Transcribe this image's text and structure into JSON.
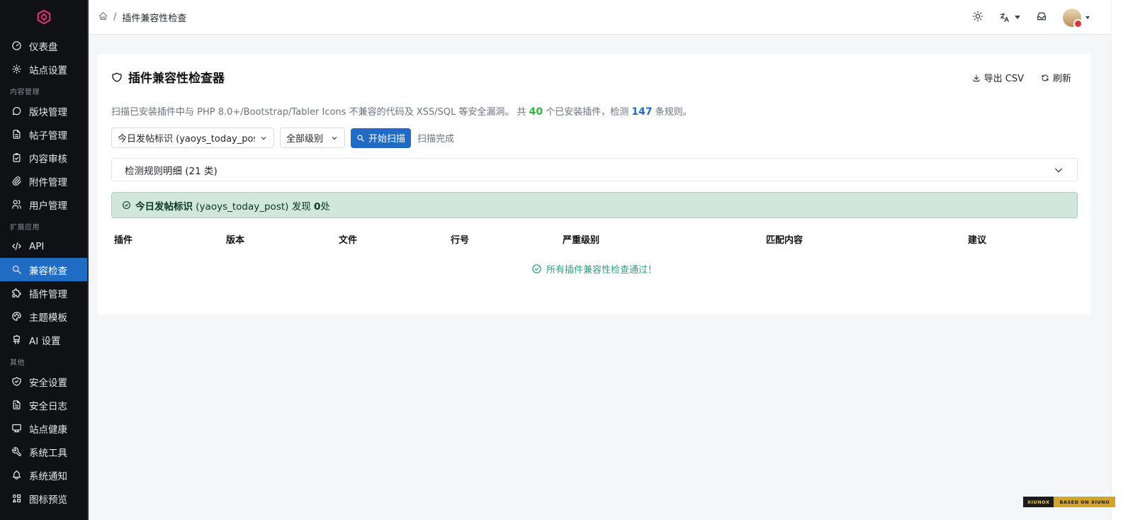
{
  "sidebar": {
    "groups": [
      {
        "label": "",
        "items": [
          {
            "label": "仪表盘",
            "icon": "dashboard-icon"
          },
          {
            "label": "站点设置",
            "icon": "gear-icon"
          }
        ]
      },
      {
        "label": "内容管理",
        "items": [
          {
            "label": "版块管理",
            "icon": "message-icon"
          },
          {
            "label": "帖子管理",
            "icon": "file-icon"
          },
          {
            "label": "内容审核",
            "icon": "clipboard-check-icon"
          },
          {
            "label": "附件管理",
            "icon": "paperclip-icon"
          },
          {
            "label": "用户管理",
            "icon": "users-icon"
          }
        ]
      },
      {
        "label": "扩展应用",
        "items": [
          {
            "label": "API",
            "icon": "code-icon"
          },
          {
            "label": "兼容检查",
            "icon": "search-icon",
            "active": true
          },
          {
            "label": "插件管理",
            "icon": "puzzle-icon"
          },
          {
            "label": "主题模板",
            "icon": "palette-icon"
          },
          {
            "label": "AI 设置",
            "icon": "robot-icon"
          }
        ]
      },
      {
        "label": "其他",
        "items": [
          {
            "label": "安全设置",
            "icon": "shield-check-icon"
          },
          {
            "label": "安全日志",
            "icon": "file-text-icon"
          },
          {
            "label": "站点健康",
            "icon": "device-desktop-icon"
          },
          {
            "label": "系统工具",
            "icon": "tool-icon"
          },
          {
            "label": "系统通知",
            "icon": "bell-icon"
          },
          {
            "label": "图标预览",
            "icon": "icons-icon"
          }
        ]
      }
    ]
  },
  "header": {
    "breadcrumb": {
      "current": "插件兼容性检查"
    }
  },
  "card": {
    "title": "插件兼容性检查器",
    "export_label": "导出 CSV",
    "refresh_label": "刷新",
    "desc_prefix": "扫描已安装插件中与 PHP 8.0+/Bootstrap/Tabler Icons 不兼容的代码及 XSS/SQL 等安全漏洞。 共 ",
    "plugin_count": "40",
    "desc_middle": " 个已安装插件，检测 ",
    "rule_count": "147",
    "desc_suffix": " 条规则。",
    "plugin_select": "今日发帖标识 (yaoys_today_post)",
    "level_select": "全部级别",
    "scan_button": "开始扫描",
    "scan_status": "扫描完成",
    "rules_accordion": "检测规则明细 (21 类)",
    "alert": {
      "plugin_name": "今日发帖标识",
      "plugin_id": " (yaoys_today_post) 发现 ",
      "count": "0",
      "suffix": "处"
    },
    "table_headers": [
      "插件",
      "版本",
      "文件",
      "行号",
      "严重级别",
      "匹配内容",
      "建议"
    ],
    "empty_message": "所有插件兼容性检查通过！"
  },
  "badge": {
    "left": "XIUNOX",
    "right": "BASED ON XIUNO"
  },
  "colors": {
    "primary": "#206bc4",
    "success": "#2fb344",
    "sidebar_bg": "#0f1115",
    "alert_bg": "#d1e7dd"
  }
}
